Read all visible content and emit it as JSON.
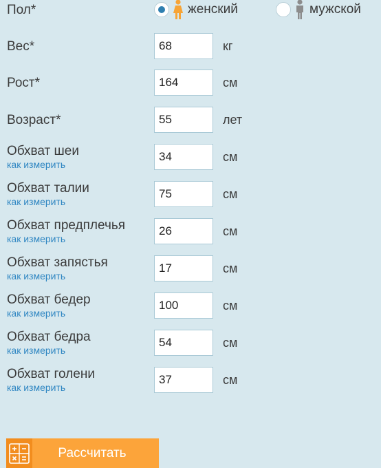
{
  "gender": {
    "label": "Пол*",
    "options": [
      {
        "label": "женский",
        "selected": true,
        "icon": "female-person-icon",
        "icon_color": "#f7a435"
      },
      {
        "label": "мужской",
        "selected": false,
        "icon": "male-person-icon",
        "icon_color": "#8c8c8c"
      }
    ]
  },
  "fields": [
    {
      "id": "weight",
      "label": "Вес*",
      "value": "68",
      "unit": "кг"
    },
    {
      "id": "height",
      "label": "Рост*",
      "value": "164",
      "unit": "см"
    },
    {
      "id": "age",
      "label": "Возраст*",
      "value": "55",
      "unit": "лет"
    },
    {
      "id": "neck",
      "label": "Обхват шеи",
      "link": "как измерить",
      "value": "34",
      "unit": "см"
    },
    {
      "id": "waist",
      "label": "Обхват талии",
      "link": "как измерить",
      "value": "75",
      "unit": "см"
    },
    {
      "id": "forearm",
      "label": "Обхват предплечья",
      "link": "как измерить",
      "value": "26",
      "unit": "см"
    },
    {
      "id": "wrist",
      "label": "Обхват запястья",
      "link": "как измерить",
      "value": "17",
      "unit": "см"
    },
    {
      "id": "hips",
      "label": "Обхват бедер",
      "link": "как измерить",
      "value": "100",
      "unit": "см"
    },
    {
      "id": "thigh",
      "label": "Обхват бедра",
      "link": "как измерить",
      "value": "54",
      "unit": "см"
    },
    {
      "id": "calf",
      "label": "Обхват голени",
      "link": "как измерить",
      "value": "37",
      "unit": "см"
    }
  ],
  "calculate_button": {
    "label": "Рассчитать",
    "icon": "calculator-icon"
  },
  "colors": {
    "background": "#d7e8ee",
    "link": "#2f86c2",
    "button": "#fca43a",
    "button_icon_bg": "#f28d1e",
    "radio_selected": "#2e7fb0"
  }
}
